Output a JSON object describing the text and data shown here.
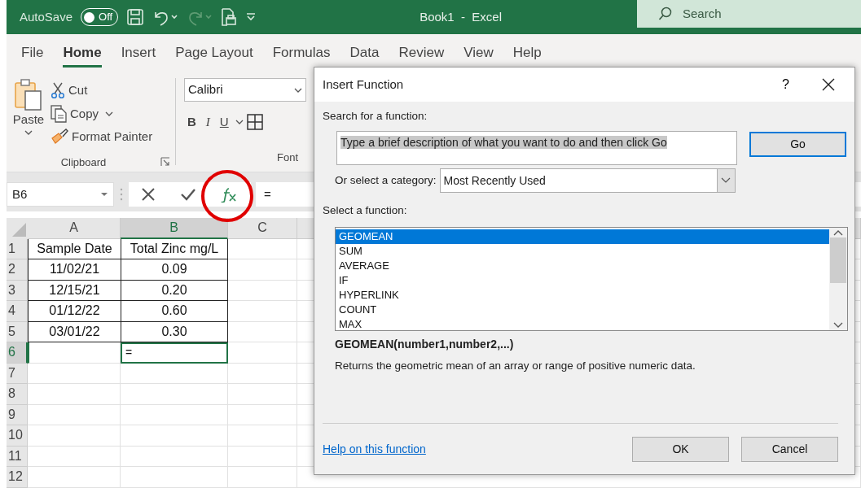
{
  "title_bar": {
    "autosave_label": "AutoSave",
    "autosave_toggle": {
      "label": "Off",
      "on": false
    },
    "title": "Book1  -  Excel",
    "search": {
      "placeholder": "Search"
    }
  },
  "ribbon_tabs": [
    {
      "label": "File",
      "selected": false
    },
    {
      "label": "Home",
      "selected": true
    },
    {
      "label": "Insert",
      "selected": false
    },
    {
      "label": "Page Layout",
      "selected": false
    },
    {
      "label": "Formulas",
      "selected": false
    },
    {
      "label": "Data",
      "selected": false
    },
    {
      "label": "Review",
      "selected": false
    },
    {
      "label": "View",
      "selected": false
    },
    {
      "label": "Help",
      "selected": false
    }
  ],
  "ribbon": {
    "clipboard": {
      "paste": "Paste",
      "cut": "Cut",
      "copy": "Copy",
      "format_painter": "Format Painter",
      "group_label": "Clipboard"
    },
    "font": {
      "font_name": "Calibri",
      "bold": "B",
      "italic": "I",
      "underline": "U",
      "group_label": "Font"
    }
  },
  "formula_bar": {
    "name_box": "B6",
    "fx_circled": true,
    "formula": "="
  },
  "sheet": {
    "columns": [
      {
        "label": "A",
        "selected": false
      },
      {
        "label": "B",
        "selected": true
      },
      {
        "label": "C",
        "selected": false
      }
    ],
    "rows": [
      {
        "number": "1",
        "selected": false,
        "a": "Sample Date",
        "b": "Total Zinc mg/L"
      },
      {
        "number": "2",
        "selected": false,
        "a": "11/02/21",
        "b": "0.09"
      },
      {
        "number": "3",
        "selected": false,
        "a": "12/15/21",
        "b": "0.20"
      },
      {
        "number": "4",
        "selected": false,
        "a": "01/12/22",
        "b": "0.60"
      },
      {
        "number": "5",
        "selected": false,
        "a": "03/01/22",
        "b": "0.30"
      },
      {
        "number": "6",
        "selected": true,
        "b": "="
      },
      {
        "number": "7",
        "selected": false
      },
      {
        "number": "8",
        "selected": false
      },
      {
        "number": "9",
        "selected": false
      },
      {
        "number": "10",
        "selected": false
      },
      {
        "number": "11",
        "selected": false
      },
      {
        "number": "12",
        "selected": false
      }
    ]
  },
  "dialog": {
    "title": "Insert Function",
    "help": "?",
    "search_label": "Search for a function:",
    "search_value": "Type a brief description of what you want to do and then click Go",
    "go_button": "Go",
    "category_label": "Or select a category:",
    "category_value": "Most Recently Used",
    "select_label": "Select a function:",
    "functions": [
      {
        "name": "GEOMEAN",
        "selected": true
      },
      {
        "name": "SUM",
        "selected": false
      },
      {
        "name": "AVERAGE",
        "selected": false
      },
      {
        "name": "IF",
        "selected": false
      },
      {
        "name": "HYPERLINK",
        "selected": false
      },
      {
        "name": "COUNT",
        "selected": false
      },
      {
        "name": "MAX",
        "selected": false
      }
    ],
    "signature": "GEOMEAN(number1,number2,...)",
    "description": "Returns the geometric mean of an array or range of positive numeric data.",
    "help_link": "Help on this function",
    "ok_button": "OK",
    "cancel_button": "Cancel"
  }
}
